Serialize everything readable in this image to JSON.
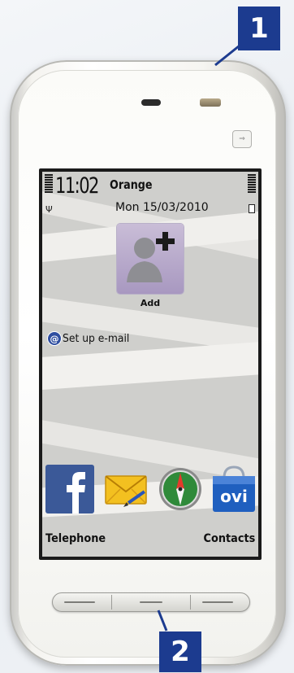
{
  "callouts": {
    "one": "1",
    "two": "2"
  },
  "status": {
    "time": "11:02",
    "operator": "Orange",
    "date": "Mon 15/03/2010"
  },
  "homescreen": {
    "add_contact_label": "Add",
    "email_shortcut_label": "Set up e-mail",
    "email_icon": "@",
    "apps": [
      {
        "name": "facebook",
        "icon": "facebook-icon"
      },
      {
        "name": "messaging",
        "icon": "envelope-icon"
      },
      {
        "name": "web-browser",
        "icon": "compass-icon"
      },
      {
        "name": "ovi-store",
        "icon": "ovi-store-icon",
        "text": "ovi"
      }
    ]
  },
  "softkeys": {
    "left": "Telephone",
    "right": "Contacts"
  },
  "colors": {
    "callout_bg": "#1c3b8f",
    "facebook_blue": "#3b5998",
    "ovi_blue": "#1f5fbf"
  }
}
